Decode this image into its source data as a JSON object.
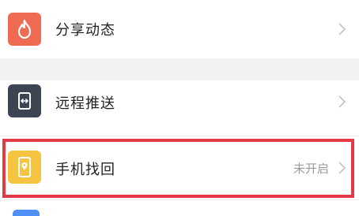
{
  "items": [
    {
      "label": "分享动态",
      "icon": "flame-icon",
      "icon_color": "#ee6a52"
    },
    {
      "label": "远程推送",
      "icon": "remote-push-icon",
      "icon_color": "#3d4452"
    },
    {
      "label": "手机找回",
      "icon": "phone-location-icon",
      "icon_color": "#f5c542",
      "status": "未开启"
    },
    {
      "label": "",
      "icon": "partial-blue-icon",
      "icon_color": "#4f8ff7"
    }
  ],
  "highlight_color": "#e23b45"
}
